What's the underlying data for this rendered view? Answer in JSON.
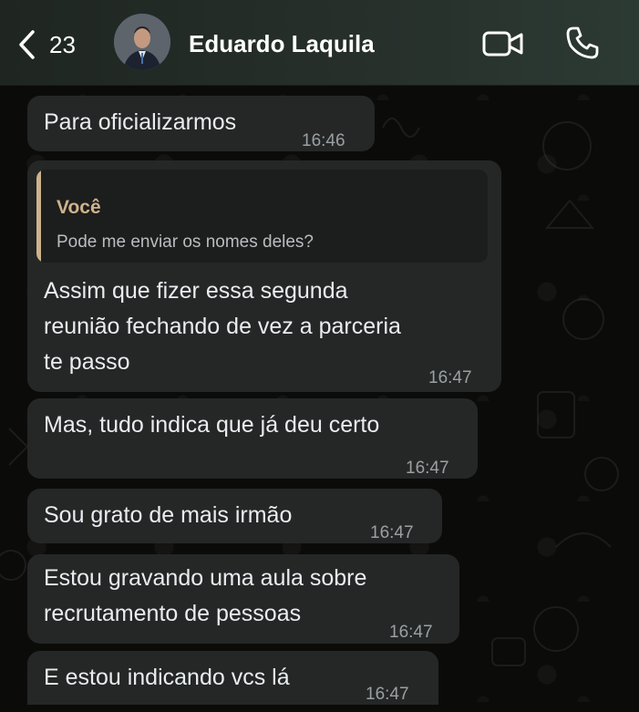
{
  "header": {
    "back_count": "23",
    "contact_name": "Eduardo Laquila"
  },
  "messages": [
    {
      "text": [
        "Para oficializarmos"
      ],
      "time": "16:46"
    },
    {
      "quote": {
        "author": "Você",
        "text": "Pode me enviar os nomes deles?"
      },
      "text": [
        "Assim que fizer essa segunda",
        "reunião fechando de vez a parceria",
        "te passo"
      ],
      "time": "16:47"
    },
    {
      "text": [
        "Mas, tudo indica que já deu certo"
      ],
      "time": "16:47"
    },
    {
      "text": [
        "Sou grato de mais irmão"
      ],
      "time": "16:47"
    },
    {
      "text": [
        "Estou gravando uma aula sobre",
        "recrutamento de pessoas"
      ],
      "time": "16:47"
    },
    {
      "text": [
        "E estou indicando vcs lá"
      ],
      "time": "16:47"
    }
  ],
  "colors": {
    "background": "#0b0b0a",
    "bubble": "#252727",
    "quote_accent": "#cdb38c",
    "timestamp": "#9aa0a2"
  }
}
